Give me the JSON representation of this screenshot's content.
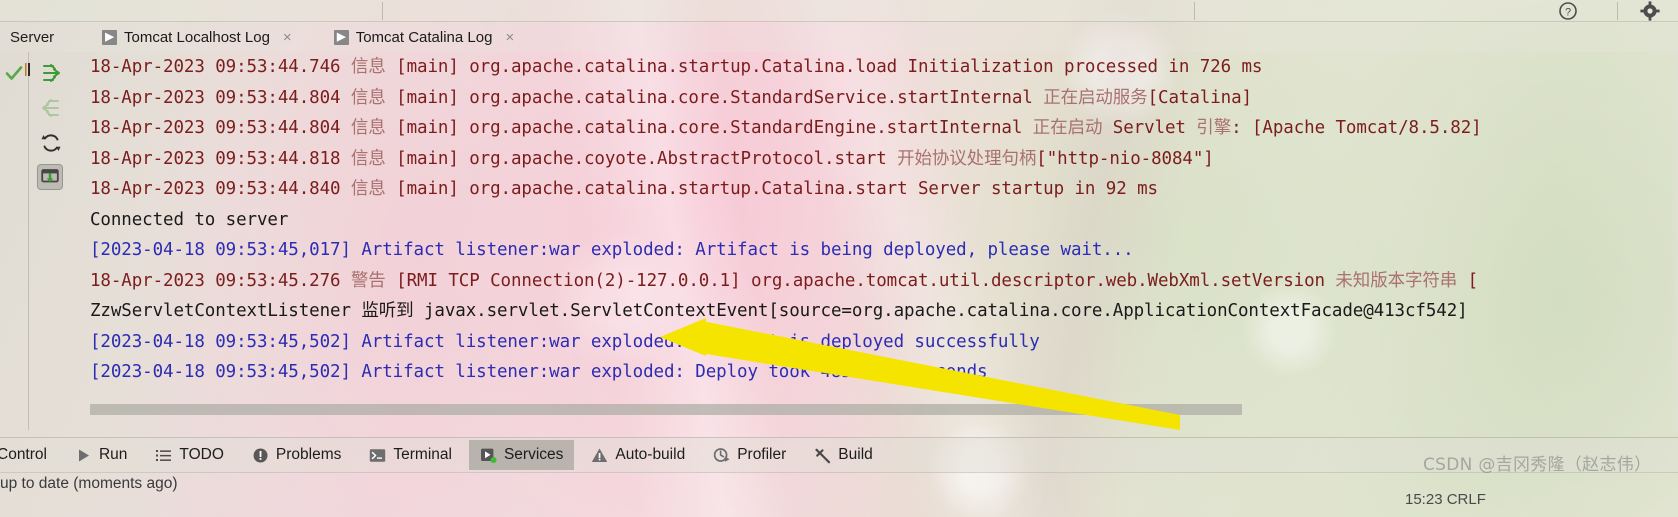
{
  "window": {
    "top_toolbar": {
      "help_icon": "help-icon",
      "settings_icon": "gear-icon"
    }
  },
  "tabs_header": {
    "section_label": "Server",
    "tabs": [
      {
        "label": "Tomcat Localhost Log",
        "icon": "run-arrow-icon",
        "close": "×"
      },
      {
        "label": "Tomcat Catalina Log",
        "icon": "run-arrow-icon",
        "close": "×"
      }
    ]
  },
  "sidebar": {
    "items": [
      {
        "name": "status-check-icon",
        "label": ""
      },
      {
        "name": "scroll-to-end-icon",
        "label": ""
      },
      {
        "name": "scroll-to-start-icon",
        "label": ""
      },
      {
        "name": "rerun-icon",
        "label": ""
      },
      {
        "name": "soft-wrap-icon",
        "label": ""
      }
    ]
  },
  "console": {
    "lines": [
      {
        "id": "log-line-1",
        "segments": [
          {
            "text": "18-Apr-2023 09:53:44.746 ",
            "style": "info"
          },
          {
            "text": "信息",
            "style": "info-cjk"
          },
          {
            "text": " [main] org.apache.catalina.startup.Catalina.load Initialization processed in 726 ms",
            "style": "info"
          }
        ]
      },
      {
        "id": "log-line-2",
        "segments": [
          {
            "text": "18-Apr-2023 09:53:44.804 ",
            "style": "info"
          },
          {
            "text": "信息",
            "style": "info-cjk"
          },
          {
            "text": " [main] org.apache.catalina.core.StandardService.startInternal ",
            "style": "info"
          },
          {
            "text": "正在启动服务",
            "style": "info-cjk"
          },
          {
            "text": "[Catalina]",
            "style": "info"
          }
        ]
      },
      {
        "id": "log-line-3",
        "segments": [
          {
            "text": "18-Apr-2023 09:53:44.804 ",
            "style": "info"
          },
          {
            "text": "信息",
            "style": "info-cjk"
          },
          {
            "text": " [main] org.apache.catalina.core.StandardEngine.startInternal ",
            "style": "info"
          },
          {
            "text": "正在启动",
            "style": "info-cjk"
          },
          {
            "text": " Servlet ",
            "style": "info"
          },
          {
            "text": "引擎",
            "style": "info-cjk"
          },
          {
            "text": ": [Apache Tomcat/8.5.82]",
            "style": "info"
          }
        ]
      },
      {
        "id": "log-line-4",
        "segments": [
          {
            "text": "18-Apr-2023 09:53:44.818 ",
            "style": "info"
          },
          {
            "text": "信息",
            "style": "info-cjk"
          },
          {
            "text": " [main] org.apache.coyote.AbstractProtocol.start ",
            "style": "info"
          },
          {
            "text": "开始协议处理句柄",
            "style": "info-cjk"
          },
          {
            "text": "[\"http-nio-8084\"]",
            "style": "info"
          }
        ]
      },
      {
        "id": "log-line-5",
        "segments": [
          {
            "text": "18-Apr-2023 09:53:44.840 ",
            "style": "info"
          },
          {
            "text": "信息",
            "style": "info-cjk"
          },
          {
            "text": " [main] org.apache.catalina.startup.Catalina.start Server startup in 92 ms",
            "style": "info"
          }
        ]
      },
      {
        "id": "log-line-6",
        "segments": [
          {
            "text": "Connected to server",
            "style": "black"
          }
        ]
      },
      {
        "id": "log-line-7",
        "segments": [
          {
            "text": "[2023-04-18 09:53:45,017] Artifact listener:war exploded: Artifact is being deployed, please wait...",
            "style": "blue"
          }
        ]
      },
      {
        "id": "log-line-8",
        "segments": [
          {
            "text": "18-Apr-2023 09:53:45.276 ",
            "style": "info"
          },
          {
            "text": "警告",
            "style": "info-cjk"
          },
          {
            "text": " [RMI TCP Connection(2)-127.0.0.1] org.apache.tomcat.util.descriptor.web.WebXml.setVersion ",
            "style": "info"
          },
          {
            "text": "未知版本字符串",
            "style": "info-cjk"
          },
          {
            "text": " [",
            "style": "info"
          }
        ]
      },
      {
        "id": "log-line-9",
        "segments": [
          {
            "text": "ZzwServletContextListener ",
            "style": "black"
          },
          {
            "text": "监听到",
            "style": "black"
          },
          {
            "text": " javax.servlet.ServletContextEvent[source=org.apache.catalina.core.ApplicationContextFacade@413cf542]",
            "style": "black"
          }
        ]
      },
      {
        "id": "log-line-10",
        "segments": [
          {
            "text": "[2023-04-18 09:53:45,502] Artifact listener:war exploded: Artifact is deployed successfully",
            "style": "blue"
          }
        ]
      },
      {
        "id": "log-line-11",
        "segments": [
          {
            "text": "[2023-04-18 09:53:45,502] Artifact listener:war exploded: Deploy took 485 milliseconds",
            "style": "blue"
          }
        ]
      }
    ]
  },
  "bottom_bar": {
    "items": [
      {
        "label": "Control",
        "icon": "version-control-icon",
        "selected": false
      },
      {
        "label": "Run",
        "icon": "run-triangle-icon",
        "selected": false
      },
      {
        "label": "TODO",
        "icon": "todo-list-icon",
        "selected": false
      },
      {
        "label": "Problems",
        "icon": "problems-icon",
        "selected": false
      },
      {
        "label": "Terminal",
        "icon": "terminal-icon",
        "selected": false
      },
      {
        "label": "Services",
        "icon": "services-icon",
        "selected": true
      },
      {
        "label": "Auto-build",
        "icon": "warning-triangle-icon",
        "selected": false
      },
      {
        "label": "Profiler",
        "icon": "profiler-icon",
        "selected": false
      },
      {
        "label": "Build",
        "icon": "hammer-icon",
        "selected": false
      }
    ]
  },
  "status_bar": {
    "text": "up to date (moments ago)",
    "clock": "15:23   CRLF"
  },
  "watermark": {
    "text": "CSDN @吉冈秀隆（赵志伟）"
  },
  "annotation": {
    "arrow_color": "#F5E400",
    "name": "yellow-pointer-arrow"
  },
  "colors": {
    "info": "#7c1d1d",
    "info_cjk": "#a9716f",
    "blue": "#2c2cb4",
    "black": "#1a1a1a",
    "selected_tab_bg": "#a6a39c",
    "arrow_yellow": "#F5E400"
  }
}
